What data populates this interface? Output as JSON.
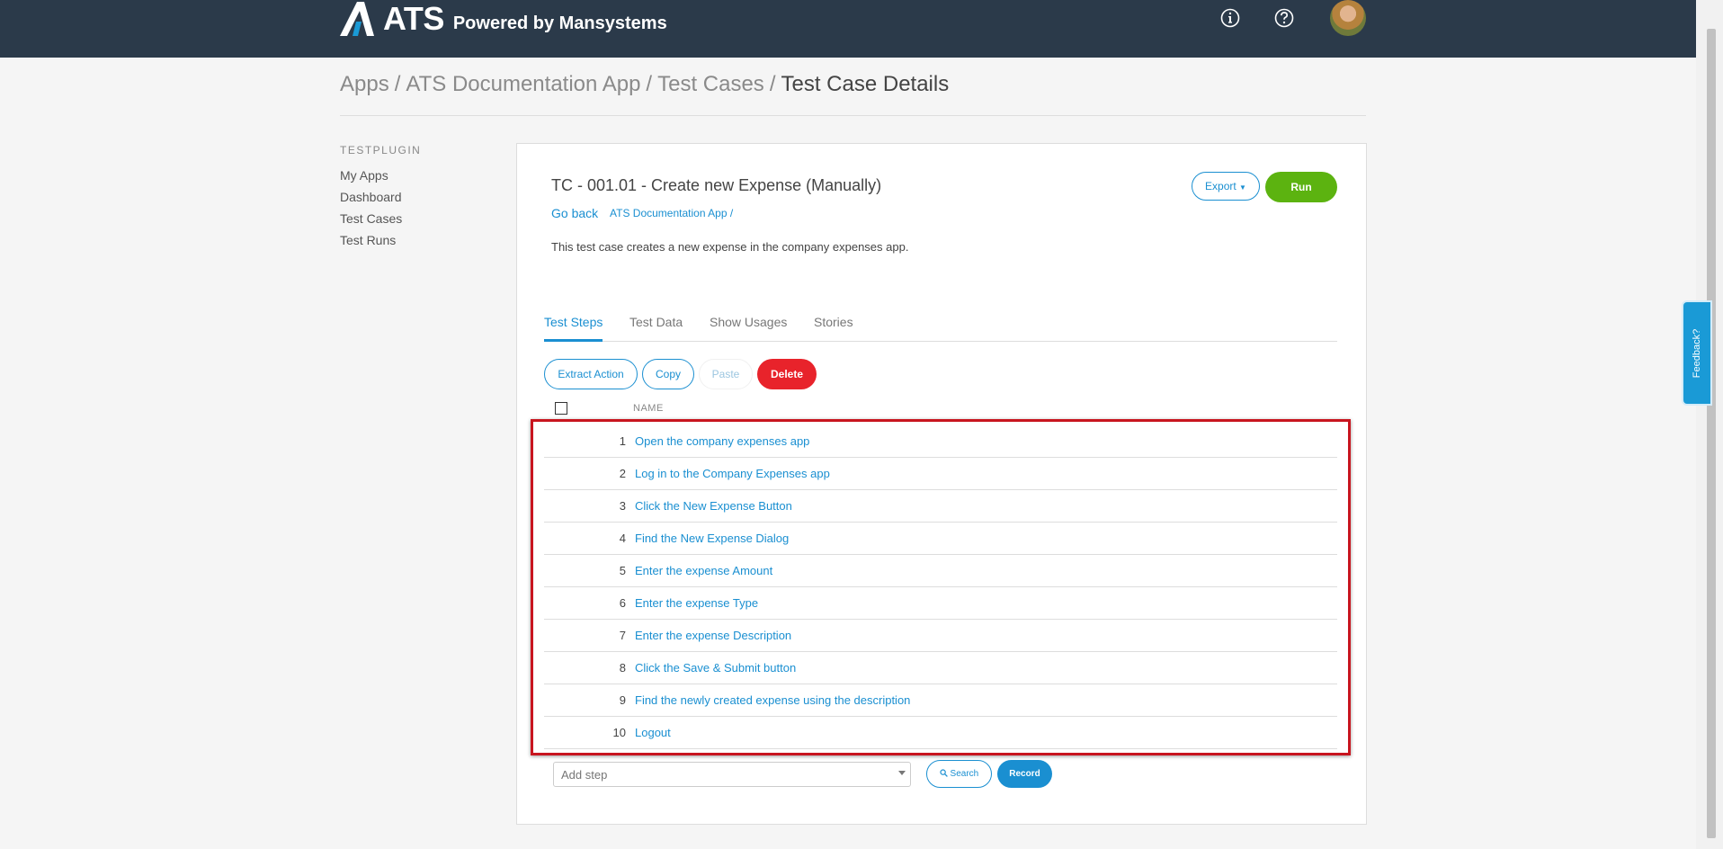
{
  "header": {
    "logo_text": "ATS",
    "tagline": "Powered by Mansystems",
    "icons": [
      "info-icon",
      "help-icon",
      "avatar"
    ]
  },
  "breadcrumb": {
    "items": [
      "Apps",
      "ATS Documentation App",
      "Test Cases"
    ],
    "separator": "/",
    "current": "Test Case Details"
  },
  "sidebar": {
    "heading": "TESTPLUGIN",
    "items": [
      "My Apps",
      "Dashboard",
      "Test Cases",
      "Test Runs"
    ]
  },
  "testcase": {
    "title": "TC - 001.01 - Create new Expense (Manually)",
    "go_back": "Go back",
    "app_link": "ATS Documentation App /",
    "description": "This test case creates a new expense in the company expenses app.",
    "export_label": "Export",
    "run_label": "Run"
  },
  "tabs": [
    "Test Steps",
    "Test Data",
    "Show Usages",
    "Stories"
  ],
  "active_tab": "Test Steps",
  "actions": {
    "extract": "Extract Action",
    "copy": "Copy",
    "paste": "Paste",
    "delete": "Delete"
  },
  "table": {
    "name_header": "NAME",
    "rows": [
      {
        "num": "1",
        "name": "Open the company expenses app"
      },
      {
        "num": "2",
        "name": "Log in to the Company Expenses app"
      },
      {
        "num": "3",
        "name": "Click the New Expense Button"
      },
      {
        "num": "4",
        "name": "Find the New Expense Dialog"
      },
      {
        "num": "5",
        "name": "Enter the expense Amount"
      },
      {
        "num": "6",
        "name": "Enter the expense Type"
      },
      {
        "num": "7",
        "name": "Enter the expense Description"
      },
      {
        "num": "8",
        "name": "Click the Save & Submit button"
      },
      {
        "num": "9",
        "name": "Find the newly created expense using the description"
      },
      {
        "num": "10",
        "name": "Logout"
      }
    ]
  },
  "add_step": {
    "placeholder": "Add step",
    "search_label": "Search",
    "record_label": "Record"
  },
  "feedback": "Feedback?",
  "colors": {
    "topbar": "#2b3a4a",
    "link": "#1a8fd1",
    "run": "#5cb310",
    "delete": "#e8232b",
    "highlight": "#c8151f"
  }
}
